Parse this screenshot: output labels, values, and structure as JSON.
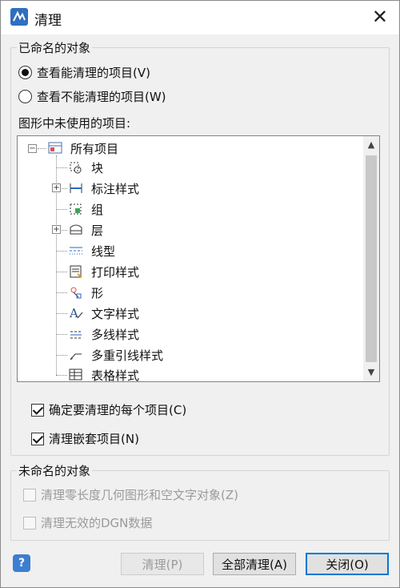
{
  "window": {
    "title": "清理",
    "close_glyph": "✕"
  },
  "named_group": {
    "title": "已命名的对象",
    "radio_view_purgeable": "查看能清理的项目(V)",
    "radio_view_unpurgeable": "查看不能清理的项目(W)",
    "tree_label": "图形中未使用的项目:",
    "tree": {
      "root": "所有项目",
      "items": [
        {
          "label": "块",
          "icon": "block-icon",
          "expandable": false
        },
        {
          "label": "标注样式",
          "icon": "dimension-style-icon",
          "expandable": true
        },
        {
          "label": "组",
          "icon": "group-icon",
          "expandable": false
        },
        {
          "label": "层",
          "icon": "layer-icon",
          "expandable": true
        },
        {
          "label": "线型",
          "icon": "linetype-icon",
          "expandable": false
        },
        {
          "label": "打印样式",
          "icon": "plot-style-icon",
          "expandable": false
        },
        {
          "label": "形",
          "icon": "shape-icon",
          "expandable": false
        },
        {
          "label": "文字样式",
          "icon": "text-style-icon",
          "expandable": false
        },
        {
          "label": "多线样式",
          "icon": "multiline-style-icon",
          "expandable": false
        },
        {
          "label": "多重引线样式",
          "icon": "multileader-style-icon",
          "expandable": false
        },
        {
          "label": "表格样式",
          "icon": "table-style-icon",
          "expandable": false
        }
      ]
    },
    "check_confirm_each": "确定要清理的每个项目(C)",
    "check_nested": "清理嵌套项目(N)"
  },
  "unnamed_group": {
    "title": "未命名的对象",
    "check_zero_length": "清理零长度几何图形和空文字对象(Z)",
    "check_dgn": "清理无效的DGN数据"
  },
  "buttons": {
    "help": "?",
    "purge": "清理(P)",
    "purge_all": "全部清理(A)",
    "close": "关闭(O)"
  },
  "state": {
    "selected_radio": "view_purgeable",
    "confirm_each_checked": true,
    "nested_checked": true,
    "zero_length_enabled": false,
    "dgn_enabled": false,
    "purge_enabled": false
  },
  "colors": {
    "accent": "#0078d7",
    "app_icon": "#2f6fbe"
  }
}
